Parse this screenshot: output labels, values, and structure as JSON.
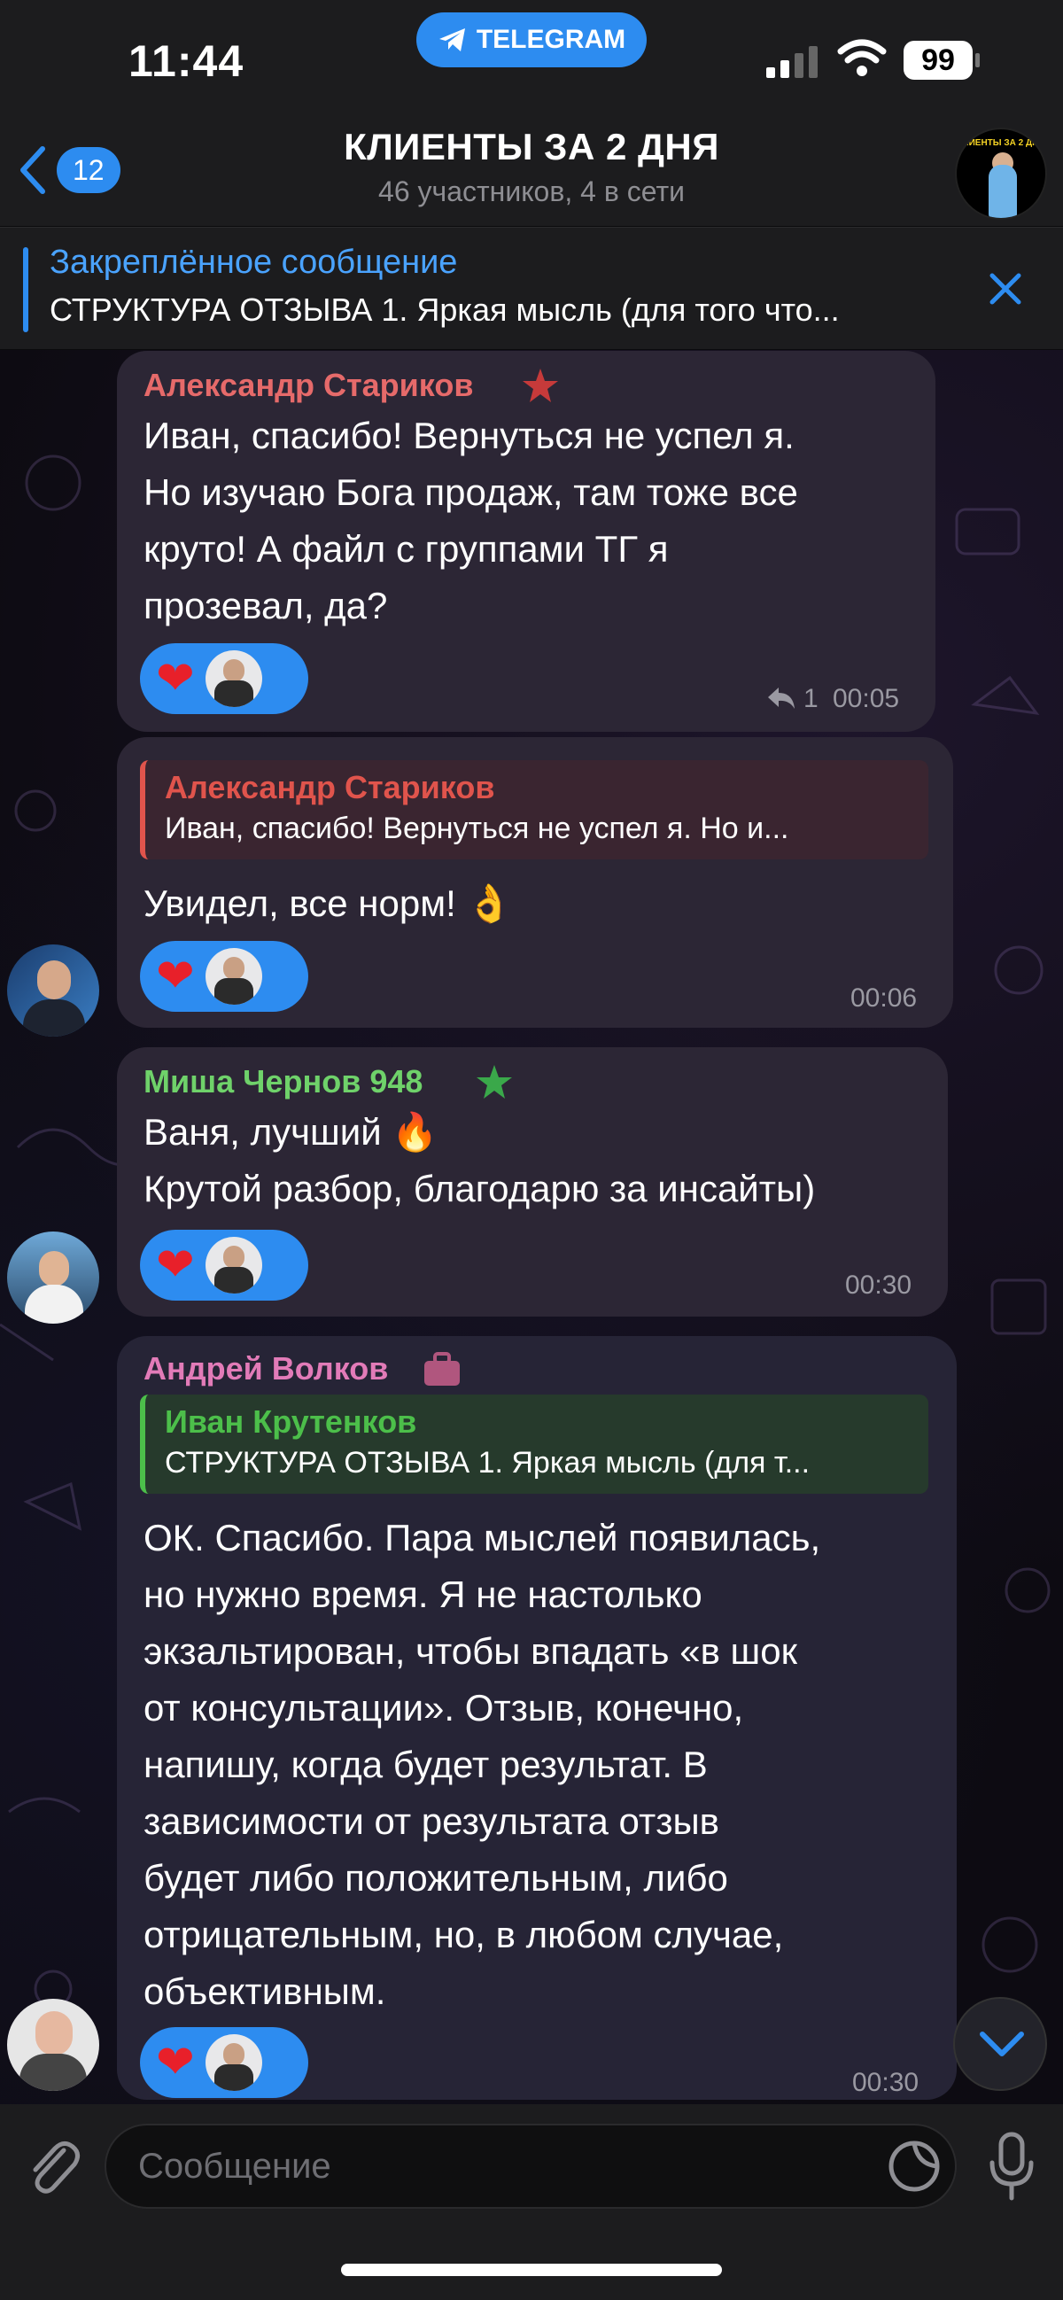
{
  "status_bar": {
    "time": "11:44",
    "app_pill": "TELEGRAM",
    "battery": "99"
  },
  "header": {
    "back_count": "12",
    "title": "КЛИЕНТЫ ЗА 2 ДНЯ",
    "subtitle": "46 участников, 4 в сети",
    "avatar_text": "КЛИЕНТЫ ЗА 2 ДНЯ"
  },
  "pinned": {
    "title": "Закреплённое сообщение",
    "text": "СТРУКТУРА ОТЗЫВА 1. Яркая мысль (для того что..."
  },
  "messages": [
    {
      "sender": "Александр Стариков",
      "sender_color": "#e66a6a",
      "badge_icon": "star-icon",
      "lines": [
        "Иван, спасибо! Вернуться не успел я.",
        "Но изучаю Бога продаж, там тоже все",
        "круто! А файл с группами ТГ я",
        "прозевал, да?"
      ],
      "reaction": "❤",
      "reply_count": "1",
      "time": "00:05"
    },
    {
      "reply_to": {
        "name": "Александр Стариков",
        "text": "Иван, спасибо! Вернуться не успел я. Но и..."
      },
      "lines": [
        "Увидел, все норм! 👌"
      ],
      "reaction": "❤",
      "time": "00:06"
    },
    {
      "sender": "Миша Чернов 948",
      "sender_color": "#6fd26a",
      "badge_icon": "star-icon",
      "lines": [
        "Ваня, лучший 🔥",
        "Крутой разбор, благодарю за инсайты)"
      ],
      "reaction": "❤",
      "time": "00:30"
    },
    {
      "sender": "Андрей Волков",
      "sender_color": "#e27bb8",
      "badge_icon": "briefcase-icon",
      "reply_to": {
        "name": "Иван Крутенков",
        "text": "СТРУКТУРА ОТЗЫВА 1. Яркая мысль (для т..."
      },
      "lines": [
        "ОК. Спасибо. Пара мыслей появилась,",
        "но нужно время. Я не настолько",
        "экзальтирован, чтобы впадать «в шок",
        "от консультации». Отзыв, конечно,",
        "напишу, когда будет результат. В",
        "зависимости от результата отзыв",
        "будет либо положительным, либо",
        "отрицательным, но, в любом случае,",
        "объективным."
      ],
      "reaction": "❤",
      "time": "00:30"
    }
  ],
  "input": {
    "placeholder": "Сообщение"
  },
  "colors": {
    "accent": "#2d8cf0",
    "bubble": "#24212a",
    "bar": "#1c1c1e"
  }
}
